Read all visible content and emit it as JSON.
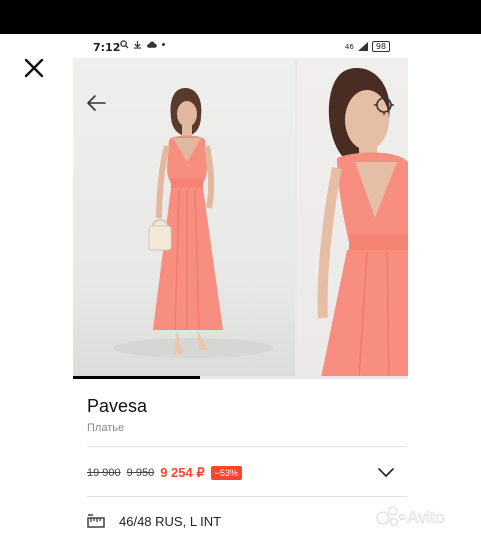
{
  "status_bar": {
    "time": "7:12",
    "network": "46",
    "battery": "98"
  },
  "product": {
    "brand": "Pavesa",
    "category": "Платье",
    "old_price_1": "19 900",
    "old_price_2": "9 950",
    "price": "9 254 ₽",
    "discount": "−53%",
    "size": "46/48 RUS, L INT"
  },
  "gallery": {
    "progress": 0.38
  },
  "colors": {
    "dress": "#f78e7f",
    "price_accent": "#f5472d",
    "background": "#e9e9e7"
  },
  "watermark": "Avito"
}
